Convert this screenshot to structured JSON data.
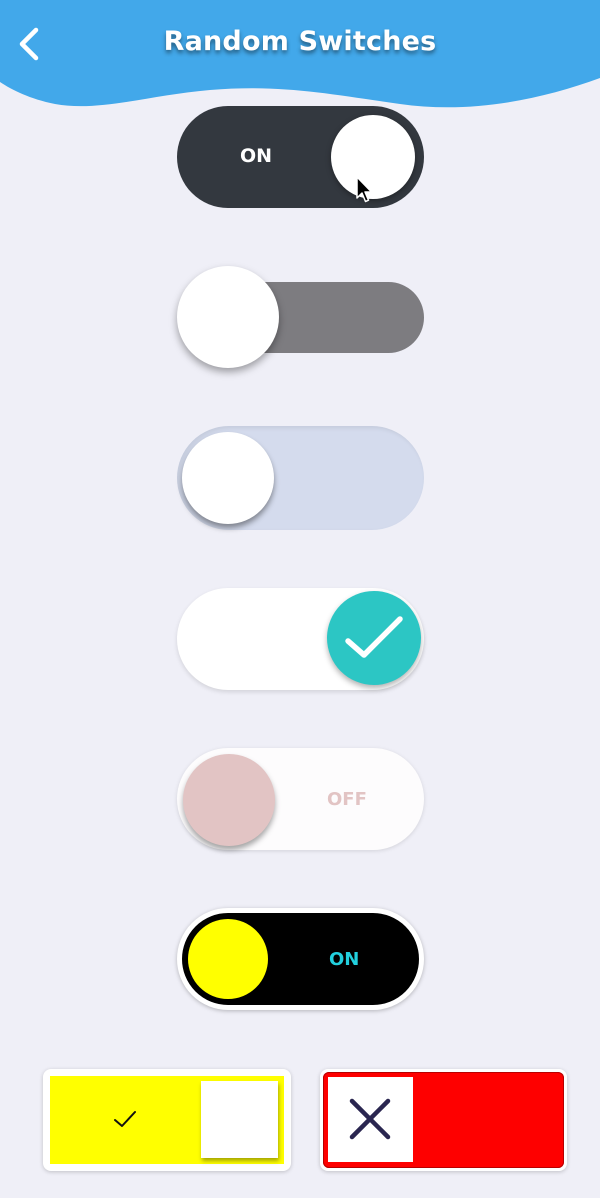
{
  "header": {
    "title": "Random Switches",
    "back_icon": "chevron-left-icon",
    "color": "#42a8ea"
  },
  "switches": [
    {
      "id": "switch-1",
      "state": "on",
      "label": "ON",
      "track_color": "#33383f",
      "knob_color": "#ffffff"
    },
    {
      "id": "switch-2",
      "state": "off",
      "track_color": "#7d7c80",
      "knob_color": "#ffffff"
    },
    {
      "id": "switch-3",
      "state": "off",
      "track_color": "#d4dbed",
      "knob_color": "#ffffff"
    },
    {
      "id": "switch-4",
      "state": "on",
      "track_color": "#ffffff",
      "knob_color": "#2cc6c4",
      "knob_icon": "checkmark-icon"
    },
    {
      "id": "switch-5",
      "state": "off",
      "label": "OFF",
      "track_color": "#fdfcfd",
      "knob_color": "#e2c4c4"
    },
    {
      "id": "switch-6",
      "state": "on",
      "label": "ON",
      "track_color": "#000000",
      "knob_color": "#ffff00",
      "label_color": "#22d0de"
    },
    {
      "id": "switch-7",
      "state": "on",
      "track_color": "#ffff00",
      "knob_color": "#ffffff",
      "icon": "checkmark-icon"
    },
    {
      "id": "switch-8",
      "state": "off",
      "track_color": "#fe0000",
      "knob_color": "#ffffff",
      "icon": "x-icon"
    }
  ],
  "background_color": "#efeff7",
  "cursor": "mouse-pointer-icon"
}
